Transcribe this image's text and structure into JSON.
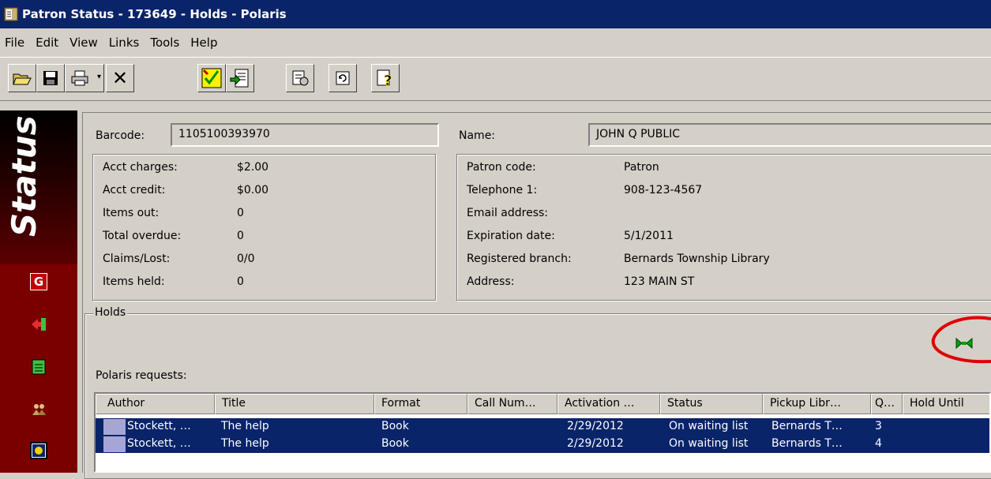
{
  "window": {
    "title": "Patron Status - 173649 - Holds - Polaris"
  },
  "menu": [
    "File",
    "Edit",
    "View",
    "Links",
    "Tools",
    "Help"
  ],
  "sidebar": {
    "label": "Status"
  },
  "patron": {
    "barcode_label": "Barcode:",
    "barcode": "1105100393970",
    "name_label": "Name:",
    "name": "JOHN Q PUBLIC",
    "account": [
      {
        "label": "Acct charges:",
        "value": "$2.00"
      },
      {
        "label": "Acct credit:",
        "value": "$0.00"
      },
      {
        "label": "Items out:",
        "value": "0"
      },
      {
        "label": "Total overdue:",
        "value": "0"
      },
      {
        "label": "Claims/Lost:",
        "value": "0/0"
      },
      {
        "label": "Items held:",
        "value": "0"
      }
    ],
    "details": [
      {
        "label": "Patron code:",
        "value": "Patron"
      },
      {
        "label": "Telephone 1:",
        "value": "908-123-4567"
      },
      {
        "label": "Email address:",
        "value": ""
      },
      {
        "label": "Expiration date:",
        "value": "5/1/2011"
      },
      {
        "label": "Registered branch:",
        "value": "Bernards Township Library"
      },
      {
        "label": "Address:",
        "value": "123 MAIN ST"
      }
    ]
  },
  "holds": {
    "group_label": "Holds",
    "requests_label": "Polaris requests:",
    "columns": [
      "Author",
      "Title",
      "Format",
      "Call Num…",
      "Activation …",
      "Status",
      "Pickup Libr…",
      "Q…",
      "Hold Until"
    ],
    "rows": [
      {
        "author": "Stockett, …",
        "title": "The help",
        "format": "Book",
        "call": "",
        "activation": "2/29/2012",
        "status": "On waiting list",
        "pickup": "Bernards T…",
        "q": "3",
        "hold_until": ""
      },
      {
        "author": "Stockett, …",
        "title": "The help",
        "format": "Book",
        "call": "",
        "activation": "2/29/2012",
        "status": "On waiting list",
        "pickup": "Bernards T…",
        "q": "4",
        "hold_until": ""
      }
    ]
  },
  "colors": {
    "titlebar": "#0a246a",
    "selection": "#0a246a",
    "sidebar": "#7a0000",
    "highlight_circle": "#e00000"
  }
}
